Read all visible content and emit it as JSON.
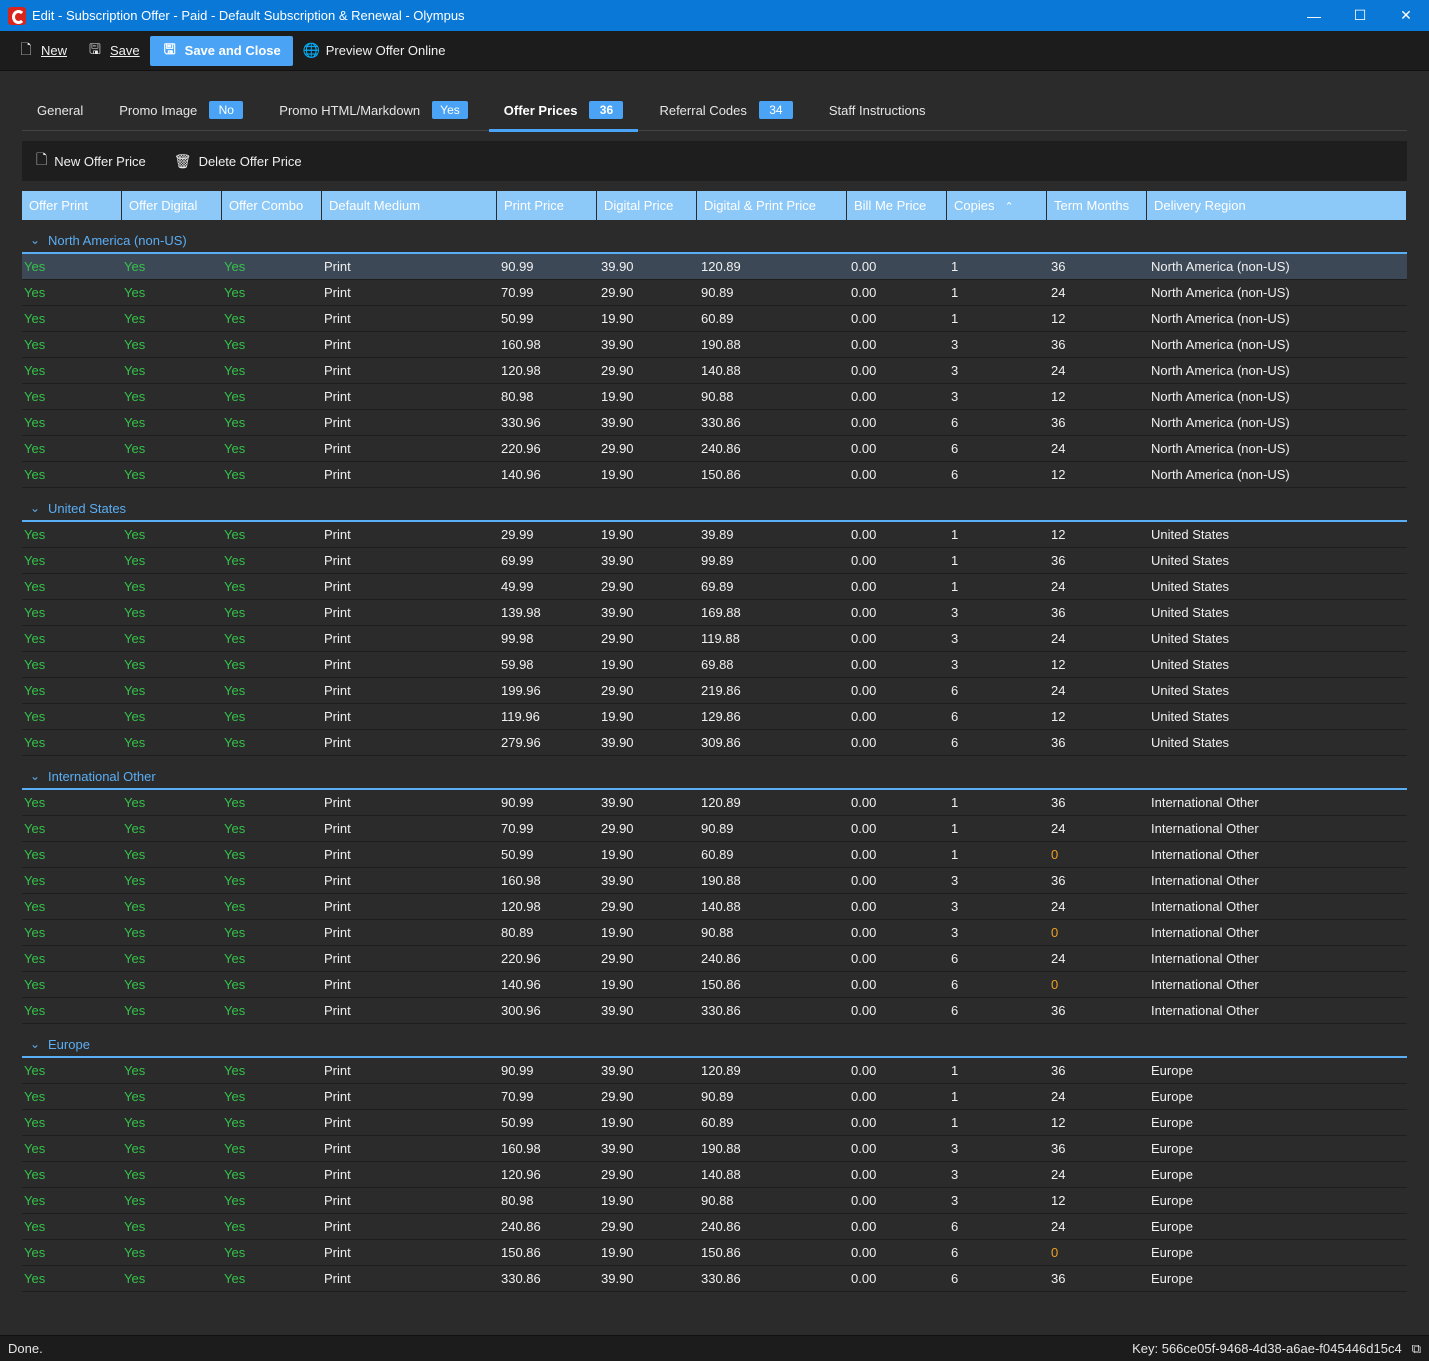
{
  "window": {
    "title": "Edit - Subscription Offer - Paid - Default Subscription & Renewal - Olympus",
    "minimize": "—",
    "maximize": "☐",
    "close": "✕"
  },
  "toolbar": {
    "new_label": "New",
    "save_label": "Save",
    "save_close_label": "Save and Close",
    "preview_label": "Preview Offer Online"
  },
  "tabs": [
    {
      "label": "General",
      "badge": null
    },
    {
      "label": "Promo Image",
      "badge": "No"
    },
    {
      "label": "Promo HTML/Markdown",
      "badge": "Yes"
    },
    {
      "label": "Offer Prices",
      "badge": "36"
    },
    {
      "label": "Referral Codes",
      "badge": "34"
    },
    {
      "label": "Staff Instructions",
      "badge": null
    }
  ],
  "subtoolbar": {
    "new_price_label": "New Offer Price",
    "delete_price_label": "Delete Offer Price"
  },
  "columns": [
    "Offer Print",
    "Offer Digital",
    "Offer Combo",
    "Default Medium",
    "Print Price",
    "Digital Price",
    "Digital & Print Price",
    "Bill Me Price",
    "Copies",
    "Term Months",
    "Delivery Region"
  ],
  "groups": [
    {
      "name": "North America (non-US)",
      "rows": [
        [
          "Yes",
          "Yes",
          "Yes",
          "Print",
          "90.99",
          "39.90",
          "120.89",
          "0.00",
          "1",
          "36",
          "North America (non-US)"
        ],
        [
          "Yes",
          "Yes",
          "Yes",
          "Print",
          "70.99",
          "29.90",
          "90.89",
          "0.00",
          "1",
          "24",
          "North America (non-US)"
        ],
        [
          "Yes",
          "Yes",
          "Yes",
          "Print",
          "50.99",
          "19.90",
          "60.89",
          "0.00",
          "1",
          "12",
          "North America (non-US)"
        ],
        [
          "Yes",
          "Yes",
          "Yes",
          "Print",
          "160.98",
          "39.90",
          "190.88",
          "0.00",
          "3",
          "36",
          "North America (non-US)"
        ],
        [
          "Yes",
          "Yes",
          "Yes",
          "Print",
          "120.98",
          "29.90",
          "140.88",
          "0.00",
          "3",
          "24",
          "North America (non-US)"
        ],
        [
          "Yes",
          "Yes",
          "Yes",
          "Print",
          "80.98",
          "19.90",
          "90.88",
          "0.00",
          "3",
          "12",
          "North America (non-US)"
        ],
        [
          "Yes",
          "Yes",
          "Yes",
          "Print",
          "330.96",
          "39.90",
          "330.86",
          "0.00",
          "6",
          "36",
          "North America (non-US)"
        ],
        [
          "Yes",
          "Yes",
          "Yes",
          "Print",
          "220.96",
          "29.90",
          "240.86",
          "0.00",
          "6",
          "24",
          "North America (non-US)"
        ],
        [
          "Yes",
          "Yes",
          "Yes",
          "Print",
          "140.96",
          "19.90",
          "150.86",
          "0.00",
          "6",
          "12",
          "North America (non-US)"
        ]
      ]
    },
    {
      "name": "United States",
      "rows": [
        [
          "Yes",
          "Yes",
          "Yes",
          "Print",
          "29.99",
          "19.90",
          "39.89",
          "0.00",
          "1",
          "12",
          "United States"
        ],
        [
          "Yes",
          "Yes",
          "Yes",
          "Print",
          "69.99",
          "39.90",
          "99.89",
          "0.00",
          "1",
          "36",
          "United States"
        ],
        [
          "Yes",
          "Yes",
          "Yes",
          "Print",
          "49.99",
          "29.90",
          "69.89",
          "0.00",
          "1",
          "24",
          "United States"
        ],
        [
          "Yes",
          "Yes",
          "Yes",
          "Print",
          "139.98",
          "39.90",
          "169.88",
          "0.00",
          "3",
          "36",
          "United States"
        ],
        [
          "Yes",
          "Yes",
          "Yes",
          "Print",
          "99.98",
          "29.90",
          "119.88",
          "0.00",
          "3",
          "24",
          "United States"
        ],
        [
          "Yes",
          "Yes",
          "Yes",
          "Print",
          "59.98",
          "19.90",
          "69.88",
          "0.00",
          "3",
          "12",
          "United States"
        ],
        [
          "Yes",
          "Yes",
          "Yes",
          "Print",
          "199.96",
          "29.90",
          "219.86",
          "0.00",
          "6",
          "24",
          "United States"
        ],
        [
          "Yes",
          "Yes",
          "Yes",
          "Print",
          "119.96",
          "19.90",
          "129.86",
          "0.00",
          "6",
          "12",
          "United States"
        ],
        [
          "Yes",
          "Yes",
          "Yes",
          "Print",
          "279.96",
          "39.90",
          "309.86",
          "0.00",
          "6",
          "36",
          "United States"
        ]
      ]
    },
    {
      "name": "International Other",
      "rows": [
        [
          "Yes",
          "Yes",
          "Yes",
          "Print",
          "90.99",
          "39.90",
          "120.89",
          "0.00",
          "1",
          "36",
          "International Other"
        ],
        [
          "Yes",
          "Yes",
          "Yes",
          "Print",
          "70.99",
          "29.90",
          "90.89",
          "0.00",
          "1",
          "24",
          "International Other"
        ],
        [
          "Yes",
          "Yes",
          "Yes",
          "Print",
          "50.99",
          "19.90",
          "60.89",
          "0.00",
          "1",
          "0",
          "International Other"
        ],
        [
          "Yes",
          "Yes",
          "Yes",
          "Print",
          "160.98",
          "39.90",
          "190.88",
          "0.00",
          "3",
          "36",
          "International Other"
        ],
        [
          "Yes",
          "Yes",
          "Yes",
          "Print",
          "120.98",
          "29.90",
          "140.88",
          "0.00",
          "3",
          "24",
          "International Other"
        ],
        [
          "Yes",
          "Yes",
          "Yes",
          "Print",
          "80.89",
          "19.90",
          "90.88",
          "0.00",
          "3",
          "0",
          "International Other"
        ],
        [
          "Yes",
          "Yes",
          "Yes",
          "Print",
          "220.96",
          "29.90",
          "240.86",
          "0.00",
          "6",
          "24",
          "International Other"
        ],
        [
          "Yes",
          "Yes",
          "Yes",
          "Print",
          "140.96",
          "19.90",
          "150.86",
          "0.00",
          "6",
          "0",
          "International Other"
        ],
        [
          "Yes",
          "Yes",
          "Yes",
          "Print",
          "300.96",
          "39.90",
          "330.86",
          "0.00",
          "6",
          "36",
          "International Other"
        ]
      ]
    },
    {
      "name": "Europe",
      "rows": [
        [
          "Yes",
          "Yes",
          "Yes",
          "Print",
          "90.99",
          "39.90",
          "120.89",
          "0.00",
          "1",
          "36",
          "Europe"
        ],
        [
          "Yes",
          "Yes",
          "Yes",
          "Print",
          "70.99",
          "29.90",
          "90.89",
          "0.00",
          "1",
          "24",
          "Europe"
        ],
        [
          "Yes",
          "Yes",
          "Yes",
          "Print",
          "50.99",
          "19.90",
          "60.89",
          "0.00",
          "1",
          "12",
          "Europe"
        ],
        [
          "Yes",
          "Yes",
          "Yes",
          "Print",
          "160.98",
          "39.90",
          "190.88",
          "0.00",
          "3",
          "36",
          "Europe"
        ],
        [
          "Yes",
          "Yes",
          "Yes",
          "Print",
          "120.96",
          "29.90",
          "140.88",
          "0.00",
          "3",
          "24",
          "Europe"
        ],
        [
          "Yes",
          "Yes",
          "Yes",
          "Print",
          "80.98",
          "19.90",
          "90.88",
          "0.00",
          "3",
          "12",
          "Europe"
        ],
        [
          "Yes",
          "Yes",
          "Yes",
          "Print",
          "240.86",
          "29.90",
          "240.86",
          "0.00",
          "6",
          "24",
          "Europe"
        ],
        [
          "Yes",
          "Yes",
          "Yes",
          "Print",
          "150.86",
          "19.90",
          "150.86",
          "0.00",
          "6",
          "0",
          "Europe"
        ],
        [
          "Yes",
          "Yes",
          "Yes",
          "Print",
          "330.86",
          "39.90",
          "330.86",
          "0.00",
          "6",
          "36",
          "Europe"
        ]
      ]
    }
  ],
  "status": {
    "left": "Done.",
    "key": "Key: 566ce05f-9468-4d38-a6ae-f045446d15c4"
  },
  "colors": {
    "accent": "#4aa3f5",
    "yes": "#34c24a",
    "warning": "#f0a020",
    "titlebar": "#0a78d7"
  }
}
